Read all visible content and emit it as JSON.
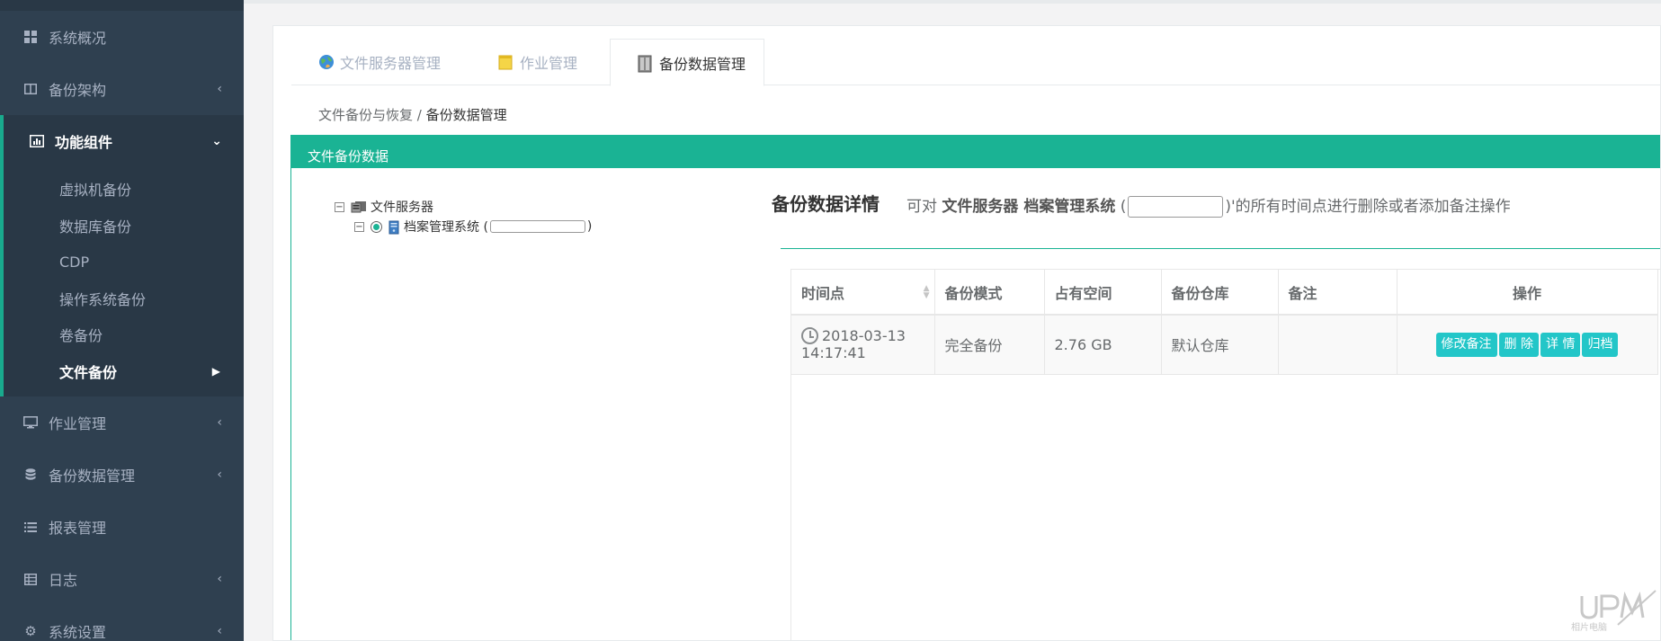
{
  "sidebar": {
    "items": [
      {
        "label": "系统概况",
        "icon": "dashboard-icon"
      },
      {
        "label": "备份架构",
        "icon": "columns-icon"
      },
      {
        "label": "功能组件",
        "icon": "bar-chart-icon"
      },
      {
        "label": "作业管理",
        "icon": "desktop-icon"
      },
      {
        "label": "备份数据管理",
        "icon": "database-icon"
      },
      {
        "label": "报表管理",
        "icon": "list-icon"
      },
      {
        "label": "日志",
        "icon": "table-icon"
      },
      {
        "label": "系统设置",
        "icon": "gear-icon"
      }
    ],
    "submenu": [
      "虚拟机备份",
      "数据库备份",
      "CDP",
      "操作系统备份",
      "卷备份",
      "文件备份"
    ]
  },
  "tabs": [
    {
      "label": "文件服务器管理",
      "icon": "globe-icon"
    },
    {
      "label": "作业管理",
      "icon": "note-icon"
    },
    {
      "label": "备份数据管理",
      "icon": "archive-icon"
    }
  ],
  "breadcrumb": {
    "parent": "文件备份与恢复 /",
    "current": "备份数据管理"
  },
  "box_title": "文件备份数据",
  "tree": {
    "root": "文件服务器",
    "child_prefix": "档案管理系统 (",
    "child_suffix": ")"
  },
  "detail": {
    "title": "备份数据详情",
    "desc_prefix": "可对",
    "desc_bold": "文件服务器 档案管理系统",
    "desc_open": "(",
    "desc_suffix": ")'的所有时间点进行删除或者添加备注操作"
  },
  "table": {
    "headers": [
      "时间点",
      "备份模式",
      "占有空间",
      "备份仓库",
      "备注",
      "操作"
    ],
    "rows": [
      {
        "time_date": "2018-03-13",
        "time_clock": "14:17:41",
        "mode": "完全备份",
        "size": "2.76 GB",
        "repo": "默认仓库",
        "note": ""
      }
    ],
    "actions": [
      "修改备注",
      "删 除",
      "详 情",
      "归档"
    ]
  },
  "watermark": {
    "text": "相片电脑"
  },
  "colors": {
    "sidebar": "#2f4050",
    "accent": "#1ab394",
    "button": "#23c6c8"
  }
}
